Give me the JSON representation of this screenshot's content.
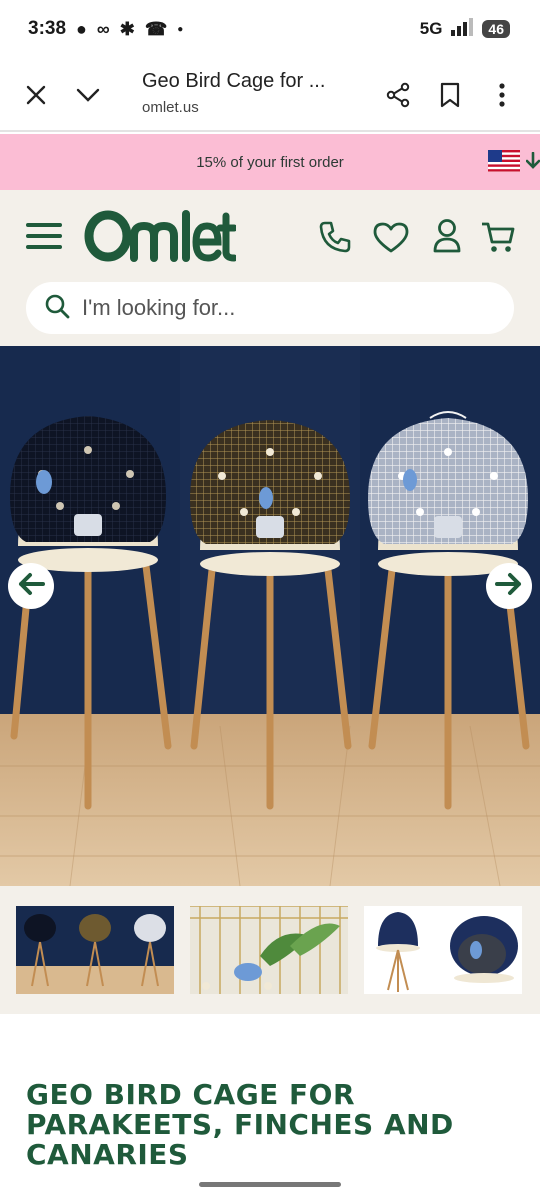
{
  "status_bar": {
    "time": "3:38",
    "network": "5G",
    "battery": "46"
  },
  "browser": {
    "title": "Geo Bird Cage for ...",
    "url": "omlet.us",
    "icons": [
      "close-icon",
      "chevron-down-icon",
      "share-icon",
      "bookmark-icon",
      "more-vertical-icon"
    ]
  },
  "promo": {
    "text": "15% of your first order"
  },
  "header": {
    "logo": "Omlet",
    "icons": [
      "menu-icon",
      "phone-icon",
      "heart-icon",
      "account-icon",
      "cart-icon"
    ]
  },
  "search": {
    "placeholder": "I'm looking for..."
  },
  "colors": {
    "brand_green": "#1f5a3b",
    "promo_pink": "#fbbdd4",
    "header_bg": "#f3f0ea"
  },
  "product": {
    "title": "GEO BIRD CAGE FOR PARAKEETS, FINCHES AND CANARIES"
  }
}
